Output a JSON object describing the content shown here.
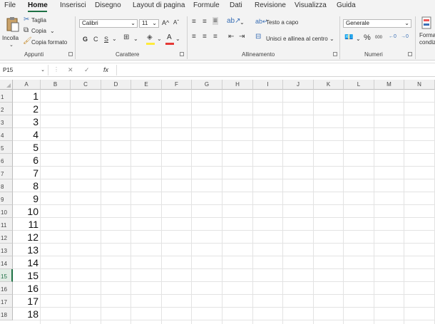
{
  "menu": {
    "tabs": [
      "File",
      "Home",
      "Inserisci",
      "Disegno",
      "Layout di pagina",
      "Formule",
      "Dati",
      "Revisione",
      "Visualizza",
      "Guida"
    ]
  },
  "ribbon": {
    "clipboard": {
      "paste_label": "Incolla",
      "cut_label": "Taglia",
      "copy_label": "Copia",
      "format_painter_label": "Copia formato",
      "group_label": "Appunti"
    },
    "font": {
      "font_name": "Calibri",
      "font_size": "11",
      "grow_label": "A^",
      "shrink_label": "Aˇ",
      "bold": "G",
      "italic": "C",
      "underline": "S",
      "font_color_letter": "A",
      "group_label": "Carattere"
    },
    "alignment": {
      "wrap_text_label": "Testo a capo",
      "merge_center_label": "Unisci e allinea al centro",
      "group_label": "Allineamento"
    },
    "number": {
      "format_value": "Generale",
      "percent_symbol": "%",
      "thousands_label": "000",
      "group_label": "Numeri"
    },
    "styles": {
      "cond_label_1": "Forma",
      "cond_label_2": "condiz"
    }
  },
  "formula_bar": {
    "name_box": "P15",
    "fx_label": "fx",
    "formula": ""
  },
  "sheet": {
    "columns": [
      "A",
      "B",
      "C",
      "D",
      "E",
      "F",
      "G",
      "H",
      "I",
      "J",
      "K",
      "L",
      "M",
      "N"
    ],
    "rows": [
      "1",
      "2",
      "3",
      "4",
      "5",
      "6",
      "7",
      "8",
      "9",
      "10",
      "11",
      "12",
      "13",
      "14",
      "15",
      "16",
      "17",
      "18"
    ],
    "column_a_values": [
      "1",
      "2",
      "3",
      "4",
      "5",
      "6",
      "7",
      "8",
      "9",
      "10",
      "11",
      "12",
      "13",
      "14",
      "15",
      "16",
      "17",
      "18"
    ],
    "selected_row": "15"
  },
  "colors": {
    "accent": "#1e7145",
    "ribbon_bg": "#f3f3f3",
    "header_bg": "#f0f0f0"
  }
}
